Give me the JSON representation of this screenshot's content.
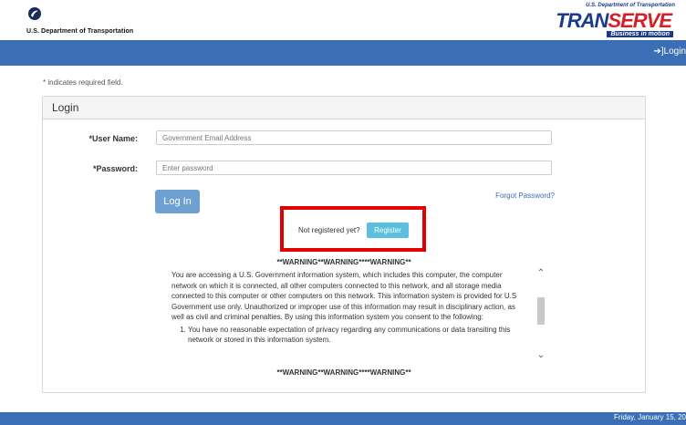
{
  "header": {
    "agency_name": "U.S. Department of Transportation",
    "brand_top": "U.S. Department of Transportation",
    "brand_main": "TRAN",
    "brand_main_accent": "SERVE",
    "brand_tagline": "Business in motion"
  },
  "navbar": {
    "login_label": "Login"
  },
  "form": {
    "required_note": "* indicates required field.",
    "panel_title": "Login",
    "username_label": "*User Name:",
    "username_placeholder": "Government Email Address",
    "password_label": "*Password:",
    "password_placeholder": "Enter password",
    "login_button": "Log In",
    "forgot_link": "Forgot Password?",
    "not_registered_text": "Not registered yet?",
    "register_button": "Register"
  },
  "warning": {
    "header": "**WARNING**WARNING****WARNING**",
    "body": "You are accessing a U.S. Government information system, which includes this computer, the computer network on which it is connected, all other computers connected to this network, and all storage media connected to this computer or other computers on this network. This information system is provided for U.S Government use only. Unauthorized or improper use of this information may result in disciplinary action, as well as civil and criminal penalties. By using this information system you consent to the following:",
    "items": [
      "You have no reasonable expectation of privacy regarding any communications or data transiting this network or stored in this information system."
    ],
    "footer": "**WARNING**WARNING****WARNING**"
  },
  "footer": {
    "date": "Friday, January 15, 20"
  },
  "colors": {
    "navbar": "#3a6fb5",
    "register": "#5bc0de",
    "highlight": "#e00000"
  }
}
